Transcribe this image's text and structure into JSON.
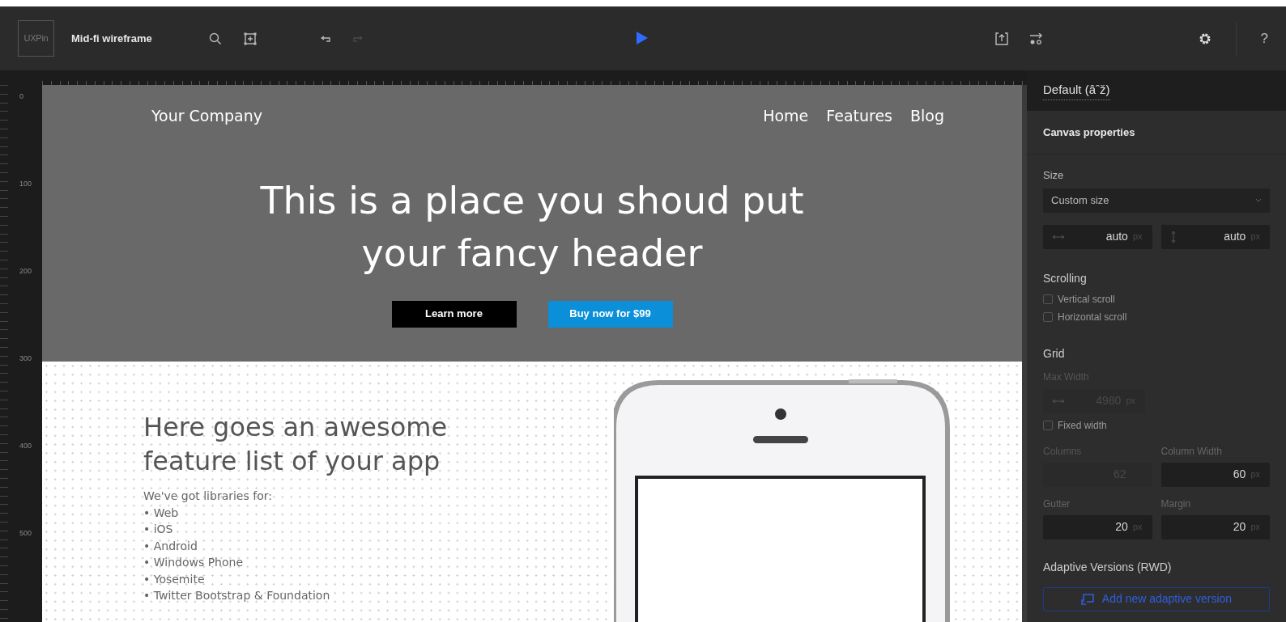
{
  "toolbar": {
    "logo": "UXPin",
    "project_title": "Mid-fi wireframe",
    "history": [
      {
        "disabled": false
      },
      {
        "disabled": true
      }
    ],
    "help": "?"
  },
  "ruler": {
    "labels": [
      "0",
      "100",
      "200",
      "300",
      "400",
      "500"
    ]
  },
  "canvas": {
    "nav": {
      "brand": "Your Company",
      "links": [
        "Home",
        "Features",
        "Blog"
      ]
    },
    "hero": {
      "headline": "This is a place you shoud put your fancy header",
      "buttons": [
        {
          "label": "Learn more",
          "kind": "dark"
        },
        {
          "label": "Buy now for $99",
          "kind": "primary"
        }
      ]
    },
    "features": {
      "heading": "Here goes an awesome feature list of your app",
      "intro": "We've got libraries for:",
      "items": [
        "• Web",
        "• iOS",
        "• Android",
        "• Windows Phone",
        "• Yosemite",
        "• Twitter Bootstrap & Foundation"
      ]
    }
  },
  "panel": {
    "version": "Default (âˆž)",
    "section": "Canvas properties",
    "size": {
      "label": "Size",
      "select": "Custom size",
      "width": {
        "value": "auto",
        "unit": "px"
      },
      "height": {
        "value": "auto",
        "unit": "px"
      }
    },
    "scrolling": {
      "label": "Scrolling",
      "options": [
        {
          "label": "Vertical scroll",
          "checked": false
        },
        {
          "label": "Horizontal scroll",
          "checked": false
        }
      ]
    },
    "grid": {
      "label": "Grid",
      "max_width": {
        "label": "Max Width",
        "value": "4980",
        "unit": "px",
        "disabled": true
      },
      "fixed_width": {
        "label": "Fixed width",
        "checked": false
      },
      "fields": [
        {
          "label": "Columns",
          "value": "62",
          "disabled": true
        },
        {
          "label": "Column Width",
          "value": "60",
          "unit": "px",
          "disabled": false
        },
        {
          "label": "Gutter",
          "value": "20",
          "unit": "px",
          "disabled": false
        },
        {
          "label": "Margin",
          "value": "20",
          "unit": "px",
          "disabled": false
        }
      ]
    },
    "adaptive": {
      "label": "Adaptive Versions (RWD)",
      "button": "Add new adaptive version"
    }
  }
}
